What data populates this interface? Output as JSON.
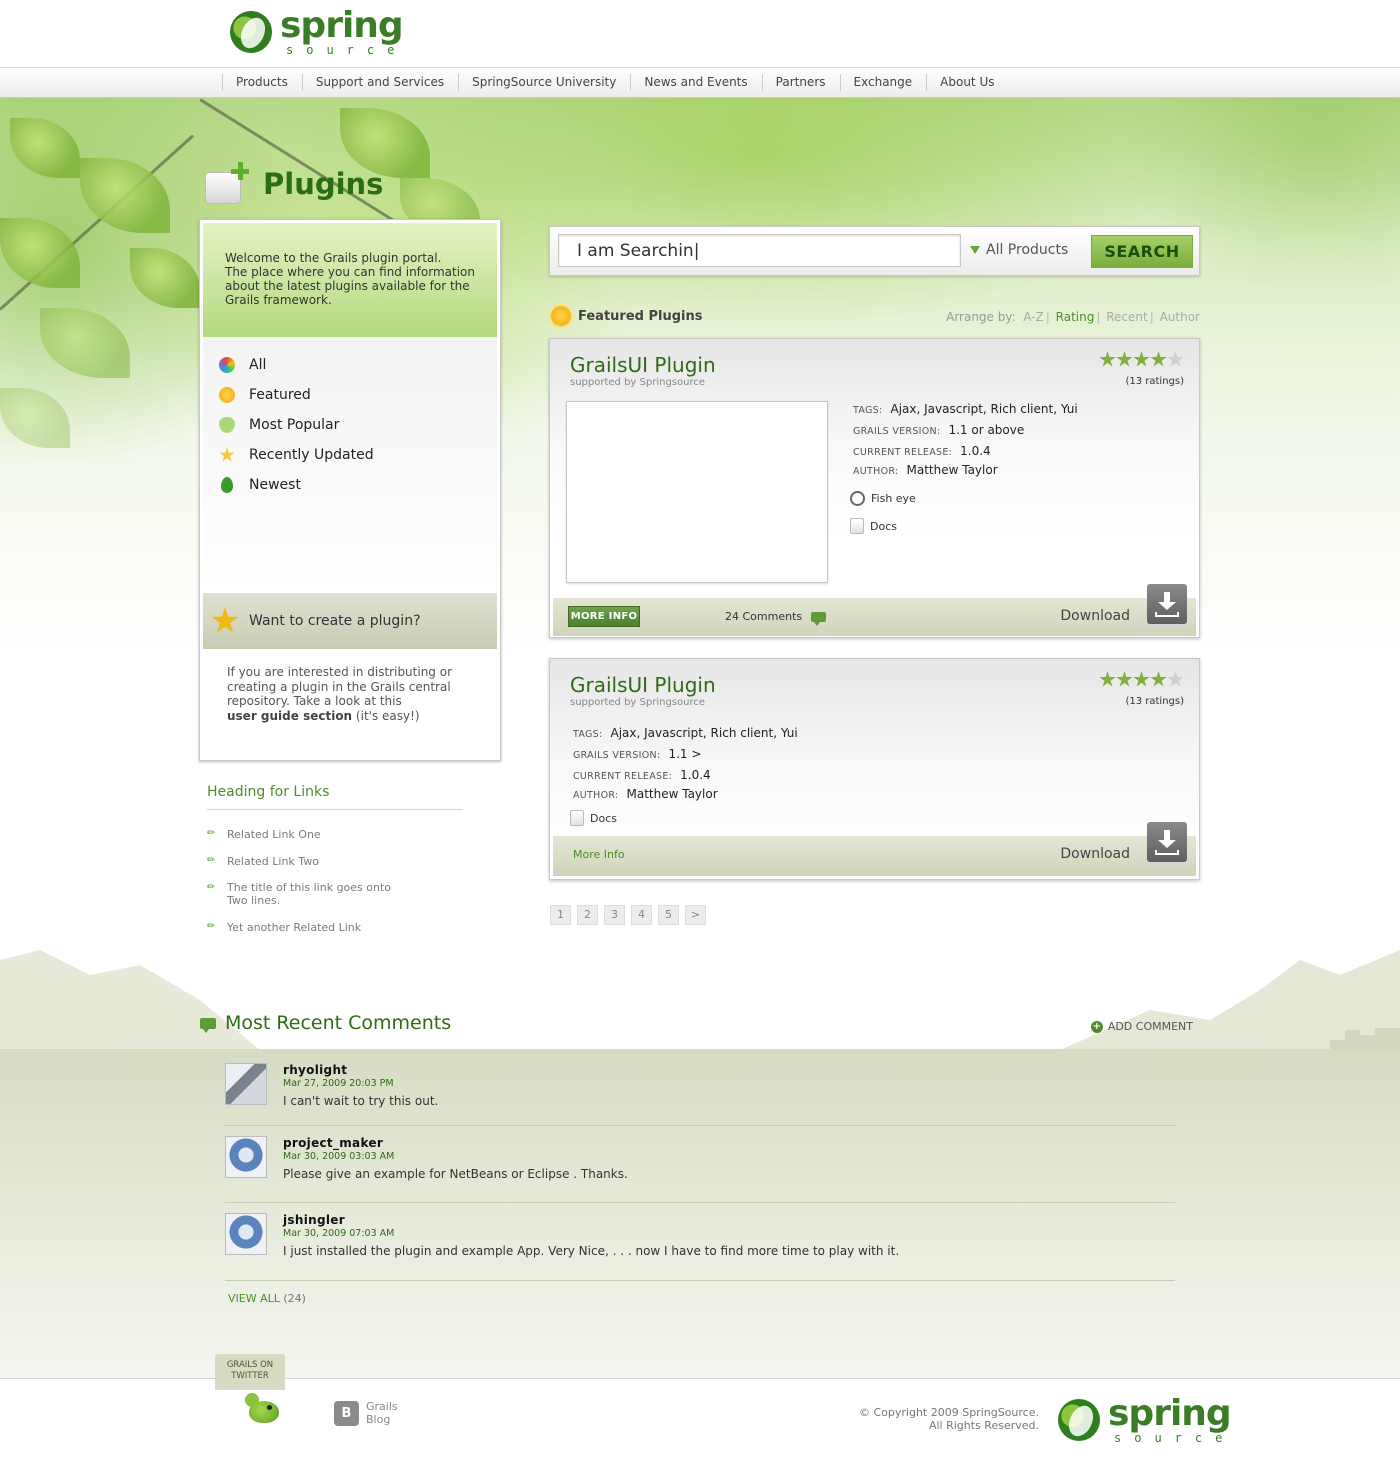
{
  "header": {
    "logo_word": "spring",
    "logo_sub": "source"
  },
  "nav": {
    "items": [
      "Products",
      "Support and Services",
      "SpringSource University",
      "News and Events",
      "Partners",
      "Exchange",
      "About Us"
    ]
  },
  "page_title": "Plugins",
  "welcome": {
    "lines": [
      "Welcome to the Grails plugin portal.",
      "The place where you can find information",
      "about the latest plugins available for the",
      "Grails framework."
    ]
  },
  "filters": [
    {
      "label": "All",
      "icon": "color-wheel-icon",
      "color": "#d9a0e0"
    },
    {
      "label": "Featured",
      "icon": "sun-icon",
      "color": "#f5b21b"
    },
    {
      "label": "Most Popular",
      "icon": "heart-icon",
      "color": "#9ed66b"
    },
    {
      "label": "Recently Updated",
      "icon": "star-burst-icon",
      "color": "#f4c93b"
    },
    {
      "label": "Newest",
      "icon": "leaf-icon",
      "color": "#3b9a2a"
    }
  ],
  "create": {
    "title": "Want to create a plugin?",
    "lines": [
      "If you are interested in distributing or",
      "creating a plugin in the Grails central",
      "repository. Take a look at this"
    ],
    "link": "user guide section",
    "suffix": " (it's easy!)"
  },
  "links": {
    "heading": "Heading for Links",
    "items": [
      [
        "Related Link One"
      ],
      [
        "Related Link Two"
      ],
      [
        "The title of this link goes onto",
        "Two lines."
      ],
      [
        "Yet another Related Link"
      ]
    ]
  },
  "search": {
    "value": "I am Searchin|",
    "product": "All Products",
    "button": "SEARCH"
  },
  "featured": {
    "title": "Featured Plugins",
    "arrange_label": "Arrange by:",
    "arrange_options": [
      "A-Z",
      "Rating",
      "Recent",
      "Author"
    ],
    "arrange_active": "Rating"
  },
  "plugins": [
    {
      "title": "GrailsUI Plugin",
      "supported": "supported by Springsource",
      "rating": 4,
      "ratings_text": "(13 ratings)",
      "tags_label": "TAGS:",
      "tags": "Ajax, Javascript, Rich client, Yui",
      "grails_label": "GRAILS VERSION:",
      "grails": "1.1 or above",
      "release_label": "CURRENT RELEASE:",
      "release": "1.0.4",
      "author_label": "AUTHOR:",
      "author": "Matthew Taylor",
      "resources": [
        "Fish eye",
        "Docs"
      ],
      "more": "MORE INFO",
      "comments": "24 Comments",
      "download": "Download"
    },
    {
      "title": "GrailsUI Plugin",
      "supported": "supported by Springsource",
      "rating": 4,
      "ratings_text": "(13 ratings)",
      "tags_label": "TAGS:",
      "tags": "Ajax, Javascript, Rich client, Yui",
      "grails_label": "GRAILS VERSION:",
      "grails": "1.1 >",
      "release_label": "CURRENT RELEASE:",
      "release": "1.0.4",
      "author_label": "AUTHOR:",
      "author": "Matthew Taylor",
      "resources": [
        "Docs"
      ],
      "more": "More Info",
      "download": "Download"
    }
  ],
  "pagination": [
    "1",
    "2",
    "3",
    "4",
    "5",
    ">"
  ],
  "comments_section": {
    "title": "Most Recent Comments",
    "add": "ADD COMMENT",
    "view_all": "VIEW ALL",
    "view_all_count": "(24)",
    "items": [
      {
        "user": "rhyolight",
        "time": "Mar 27, 2009 20:03 PM",
        "text": " I can't wait to try this out."
      },
      {
        "user": "project_maker",
        "time": "Mar 30, 2009 03:03 AM",
        "text": "Please give an example for NetBeans or Eclipse . Thanks."
      },
      {
        "user": "jshingler",
        "time": "Mar 30, 2009 07:03 AM",
        "text": " I just installed the plugin and example App. Very Nice, . . . now I have to find more time to play with it."
      }
    ]
  },
  "footer": {
    "twitter_line1": "GRAILS ON",
    "twitter_line2": "TWITTER",
    "blog_line1": "Grails",
    "blog_line2": "Blog",
    "copyright_line1": "© Copyright 2009 SpringSource.",
    "copyright_line2": "All Rights Reserved."
  },
  "colors": {
    "brand_green": "#2e6b15",
    "accent_green": "#7aae3c",
    "comments_band": "#d6dcc4"
  }
}
